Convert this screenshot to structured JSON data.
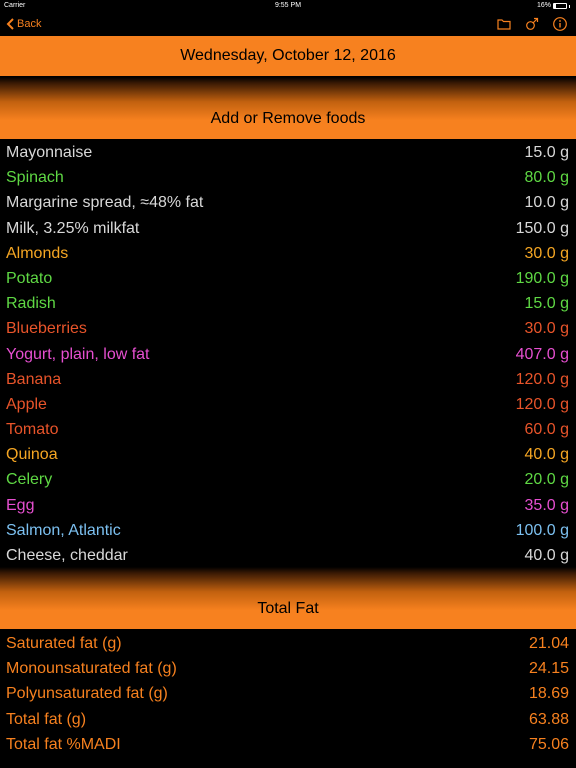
{
  "status": {
    "carrier": "Carrier",
    "time": "9:55 PM",
    "battery": "16%",
    "battery_level": 0.16
  },
  "nav": {
    "back_label": "Back"
  },
  "date": "Wednesday, October 12, 2016",
  "foods_section": {
    "title": "Add or Remove foods"
  },
  "foods": [
    {
      "name": "Mayonnaise",
      "amount": "15.0 g",
      "color": "#d8d8d8"
    },
    {
      "name": "Spinach",
      "amount": "80.0 g",
      "color": "#5fd844"
    },
    {
      "name": "Margarine spread, ≈48% fat",
      "amount": "10.0 g",
      "color": "#d8d8d8"
    },
    {
      "name": "Milk, 3.25% milkfat",
      "amount": "150.0 g",
      "color": "#d8d8d8"
    },
    {
      "name": "Almonds",
      "amount": "30.0 g",
      "color": "#f5a623"
    },
    {
      "name": "Potato",
      "amount": "190.0 g",
      "color": "#5fd844"
    },
    {
      "name": "Radish",
      "amount": "15.0 g",
      "color": "#5fd844"
    },
    {
      "name": "Blueberries",
      "amount": "30.0 g",
      "color": "#e8542a"
    },
    {
      "name": "Yogurt, plain, low fat",
      "amount": "407.0 g",
      "color": "#e64fd0"
    },
    {
      "name": "Banana",
      "amount": "120.0 g",
      "color": "#e8542a"
    },
    {
      "name": "Apple",
      "amount": "120.0 g",
      "color": "#e8542a"
    },
    {
      "name": "Tomato",
      "amount": "60.0 g",
      "color": "#e8542a"
    },
    {
      "name": "Quinoa",
      "amount": "40.0 g",
      "color": "#f5a623"
    },
    {
      "name": "Celery",
      "amount": "20.0 g",
      "color": "#5fd844"
    },
    {
      "name": "Egg",
      "amount": "35.0 g",
      "color": "#e64fd0"
    },
    {
      "name": "Salmon, Atlantic",
      "amount": "100.0 g",
      "color": "#7cc0f0"
    },
    {
      "name": "Cheese, cheddar",
      "amount": "40.0 g",
      "color": "#d8d8d8"
    }
  ],
  "fat_section": {
    "title": "Total Fat"
  },
  "fats": [
    {
      "name": "Saturated fat (g)",
      "value": "21.04"
    },
    {
      "name": "Monounsaturated fat (g)",
      "value": "24.15"
    },
    {
      "name": "Polyunsaturated fat (g)",
      "value": "18.69"
    },
    {
      "name": "Total fat (g)",
      "value": "63.88"
    },
    {
      "name": "Total fat %MADI",
      "value": "75.06"
    }
  ],
  "colors": {
    "accent": "#f7811f",
    "fat_text": "#f7811f"
  },
  "icons": [
    "chevron-left-icon",
    "folder-icon",
    "gender-icon",
    "info-icon"
  ]
}
